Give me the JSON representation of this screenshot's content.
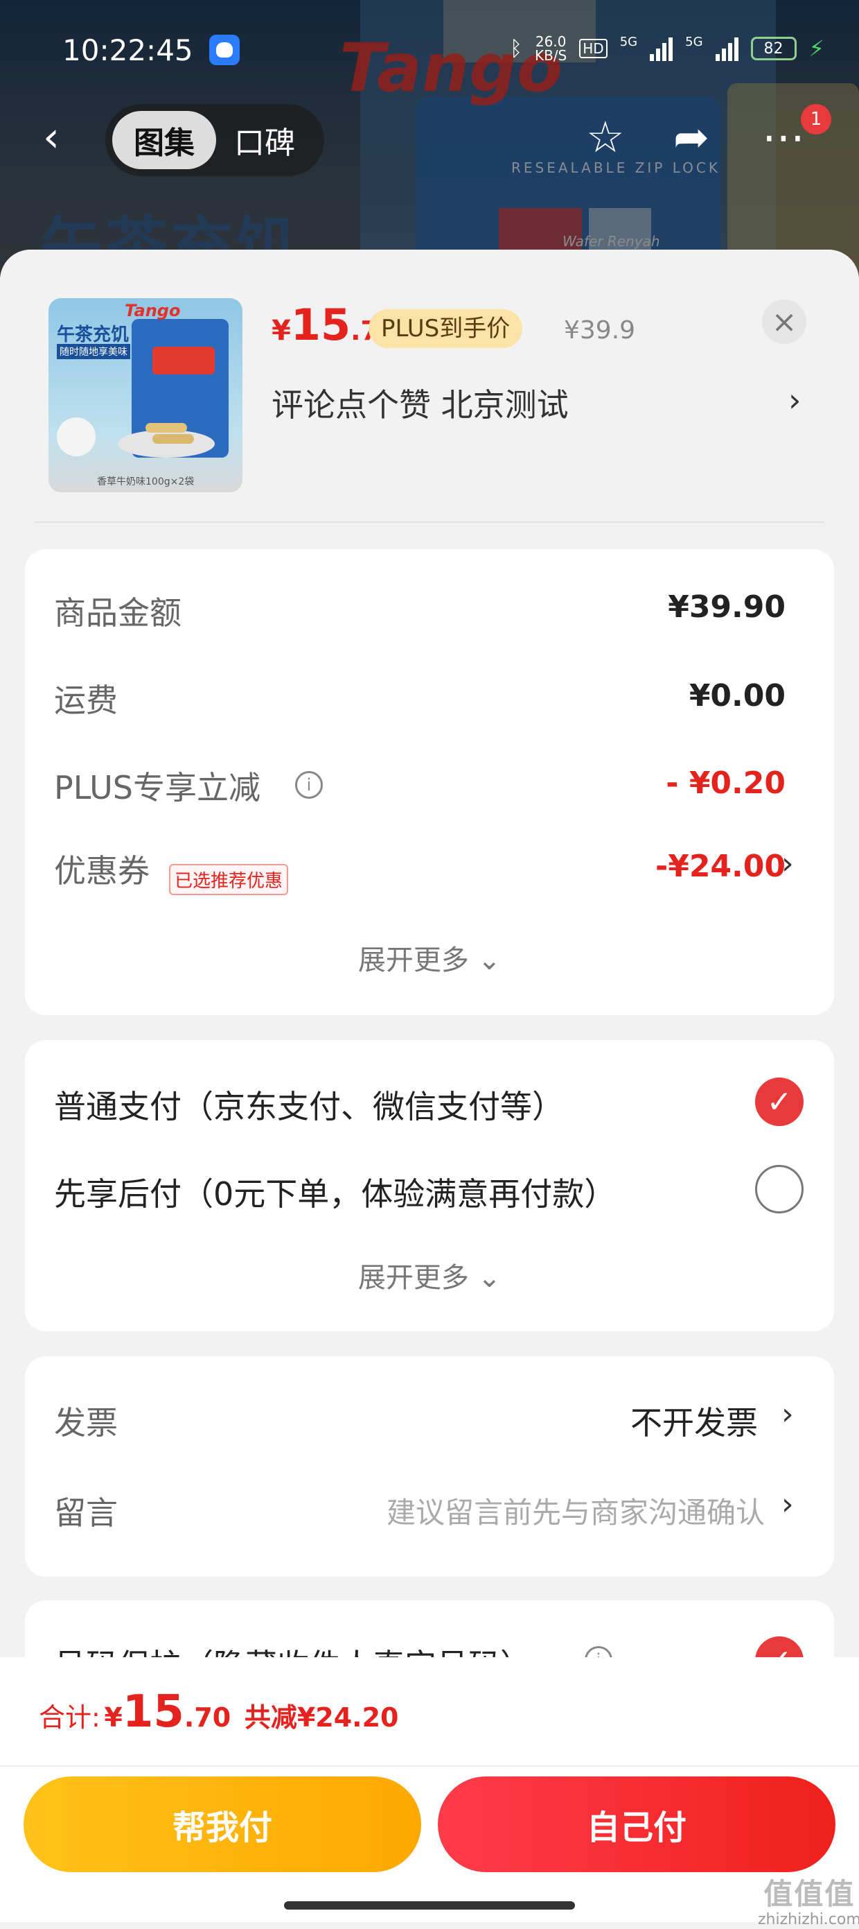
{
  "status_bar": {
    "time": "10:22:45",
    "net_speed_value": "26.0",
    "net_speed_unit": "KB/S",
    "hd_label": "HD",
    "network_1": "5G",
    "network_2": "5G",
    "battery": "82"
  },
  "background_page": {
    "brand_text": "Tango",
    "hero_text": "午茶充饥",
    "package_caption": "RESEALABLE ZIP LOCK",
    "package_sub": "Wafer Renyah",
    "tabs": [
      {
        "label": "图集",
        "active": true
      },
      {
        "label": "口碑",
        "active": false
      }
    ],
    "badge_count": "1"
  },
  "product": {
    "thumb_brand": "Tango",
    "thumb_title": "午茶充饥",
    "thumb_sub": "随时随地享美味",
    "thumb_footer": "香草牛奶味100g×2袋",
    "price_yen": "¥",
    "price_int": "15",
    "price_dec": ".7",
    "plus_tag": "PLUS到手价",
    "orig_price": "¥39.9",
    "desc": "评论点个赞  北京测试",
    "close_symbol": "×"
  },
  "summary": {
    "goods_amount_label": "商品金额",
    "goods_amount_value": "¥39.90",
    "shipping_label": "运费",
    "shipping_value": "¥0.00",
    "plus_discount_label": "PLUS专享立减",
    "plus_discount_value": "- ¥0.20",
    "coupon_label": "优惠券",
    "coupon_tag": "已选推荐优惠",
    "coupon_value": "-¥24.00",
    "expand_label": "展开更多"
  },
  "payment": {
    "options": [
      {
        "label": "普通支付（京东支付、微信支付等）",
        "selected": true
      },
      {
        "label": "先享后付（0元下单，体验满意再付款）",
        "selected": false
      }
    ],
    "expand_label": "展开更多"
  },
  "extras": {
    "invoice_label": "发票",
    "invoice_value": "不开发票",
    "message_label": "留言",
    "message_placeholder": "建议留言前先与商家沟通确认"
  },
  "partial_row": {
    "label": "号码保护（隐藏收件人真实号码）"
  },
  "footer": {
    "total_label": "合计:",
    "total_yen": "¥",
    "total_int": "15",
    "total_dec": ".70",
    "saving": "共减¥24.20",
    "help_pay_label": "帮我付",
    "self_pay_label": "自己付"
  },
  "watermark": {
    "logo": "值值值",
    "site": "zhizhizhi.com"
  },
  "colors": {
    "accent_red": "#e4231f",
    "plus_gold_bg": "#fbe2a6",
    "help_button": "#ffb300",
    "self_button": "#f0201c"
  },
  "icons": [
    "back-arrow-icon",
    "star-icon",
    "share-icon",
    "more-icon",
    "close-icon",
    "chevron-right-icon",
    "info-icon",
    "check-icon",
    "chevron-down-icon"
  ]
}
